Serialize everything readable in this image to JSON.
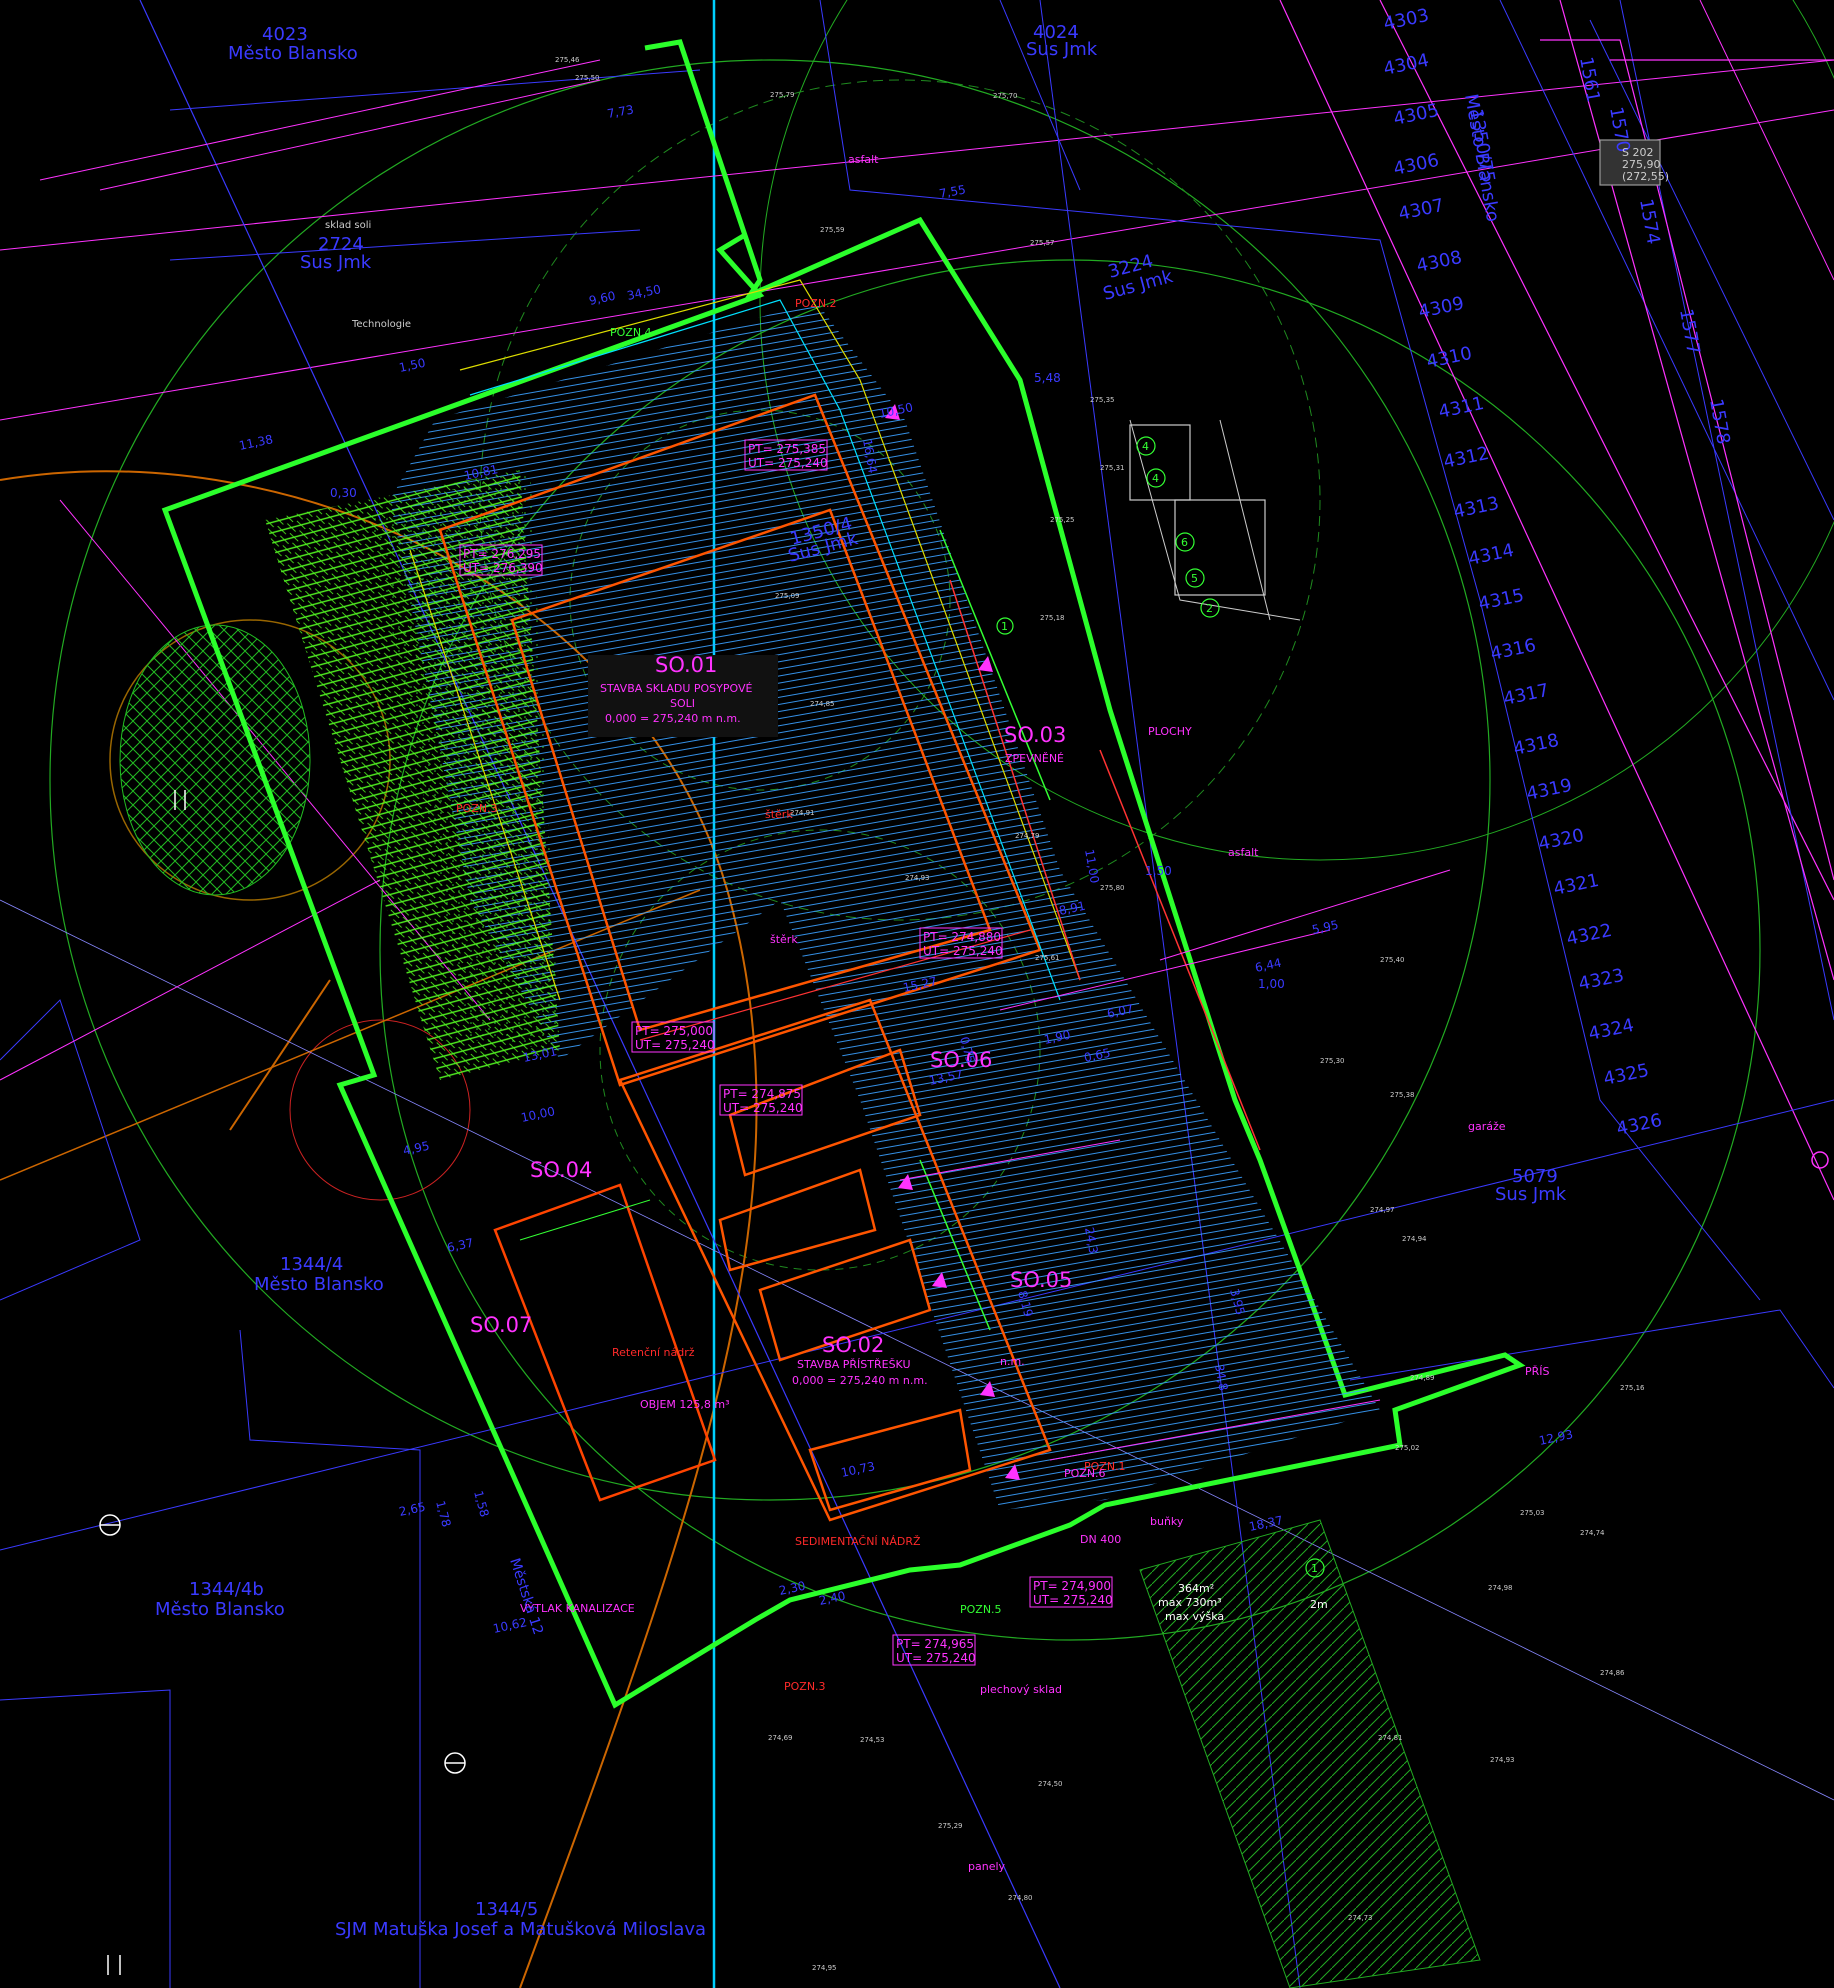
{
  "parcels": [
    {
      "num": "4023",
      "owner": "Město Blansko"
    },
    {
      "num": "4024",
      "owner": "Sus Jmk"
    },
    {
      "num": "2724",
      "owner": "Sus Jmk"
    },
    {
      "num": "3224",
      "owner": "Sus Jmk"
    },
    {
      "num": "1350/4",
      "owner": "Sus Jmk"
    },
    {
      "num": "5079",
      "owner": "Sus Jmk"
    },
    {
      "num": "1344/4",
      "owner": "Město Blansko"
    },
    {
      "num": "1344/4b",
      "owner": "Město Blansko"
    },
    {
      "num": "1344/5",
      "owner": "SJM Matuška Josef a Matušková Miloslava"
    },
    {
      "num": "1350/75",
      "owner": "Město Blansko"
    }
  ],
  "parcel_side_numbers": [
    "4303",
    "4304",
    "4305",
    "4306",
    "4307",
    "4308",
    "4309",
    "4310",
    "4311",
    "4312",
    "4313",
    "4314",
    "4315",
    "4316",
    "4317",
    "4318",
    "4319",
    "4320",
    "4321",
    "4322",
    "4323",
    "4324",
    "4325",
    "4326"
  ],
  "right_column_numbers": [
    "1561",
    "1570",
    "1574",
    "1577",
    "1578"
  ],
  "objects": {
    "so01": {
      "code": "SO.01",
      "l1": "STAVBA SKLADU POSYPOVÉ",
      "l2": "SOLI",
      "l3": "0,000 = 275,240 m n.m."
    },
    "so02": {
      "code": "SO.02",
      "l1": "STAVBA PŘÍSTŘEŠKU",
      "l2": "0,000 = 275,240 m n.m."
    },
    "so03": {
      "code": "SO.03",
      "l1": "ZPEVNĚNÉ",
      "l2": "PLOCHY"
    },
    "so04": {
      "code": "SO.04"
    },
    "so05": {
      "code": "SO.05",
      "l1": "n.m."
    },
    "so06": {
      "code": "SO.06"
    },
    "so07": {
      "code": "SO.07"
    }
  },
  "notes": {
    "pozn1": "POZN.1",
    "pozn2": "POZN.2",
    "pozn3": "POZN.3",
    "pozn3b": "POZN.3",
    "pozn4": "POZN.4",
    "pozn5": "POZN.5",
    "pozn6": "POZN.6",
    "retencni": "Retenční nádrž",
    "objem": "OBJEM 125,8 m³",
    "vytlak": "VÝTLAK KANALIZACE",
    "sedim": "SEDIMENTAČNÍ NÁDRŽ",
    "technologie": "Technologie",
    "sklad_soli": "sklad soli",
    "asfalt": "asfalt",
    "asfalt2": "asfalt",
    "sterk": "štěrk",
    "sterk2": "štěrk",
    "garaze": "garáže",
    "plechovy": "plechový sklad",
    "panely": "panely",
    "pris": "PŘÍS",
    "stack1": "364m²",
    "stack2": "max 730m³",
    "stack3": "max výška",
    "stack4": "2m",
    "bunky": "buňky",
    "dn400": "DN 400",
    "s202": "S 202",
    "s202v": "275,90",
    "s202p": "(272,55)",
    "u12": "Městská 12"
  },
  "level_boxes": [
    {
      "pt": "PT= 276,295",
      "ut": "UT= 276,390"
    },
    {
      "pt": "PT= 275,385",
      "ut": "UT= 275,240"
    },
    {
      "pt": "PT= 274,880",
      "ut": "UT= 275,240"
    },
    {
      "pt": "PT= 275,000",
      "ut": "UT= 275,240"
    },
    {
      "pt": "PT= 274,875",
      "ut": "UT= 275,240"
    },
    {
      "pt": "PT= 274,900",
      "ut": "UT= 275,240"
    },
    {
      "pt": "PT= 274,965",
      "ut": "UT= 275,240"
    }
  ],
  "dimensions": [
    "7,73",
    "7,55",
    "9,60",
    "34,50",
    "1,50",
    "11,38",
    "0,30",
    "10,81",
    "5,48",
    "10,50",
    "16,64",
    "11,00",
    "1,50",
    "8,91",
    "6,44",
    "1,00",
    "5,95",
    "15,27",
    "13,01",
    "10,00",
    "4,95",
    "6,37",
    "13,57",
    "6,07",
    "0,65",
    "2,65",
    "1,78",
    "1,58",
    "10,62",
    "10,73",
    "12,93",
    "18,37",
    "34,8",
    "24,3",
    "2,30",
    "2,40",
    "8,19",
    "0,75",
    "1,90",
    "3,95"
  ],
  "numbered_circles": [
    "4",
    "4",
    "6",
    "5",
    "2",
    "1",
    "1"
  ],
  "spot_heights": [
    "275,46",
    "275,50",
    "275,79",
    "275,70",
    "275,59",
    "275,57",
    "275,35",
    "275,31",
    "275,25",
    "275,18",
    "275,09",
    "274,85",
    "274,91",
    "274,93",
    "274,79",
    "275,80",
    "275,61",
    "275,40",
    "275,30",
    "275,38",
    "274,94",
    "274,97",
    "274,89",
    "275,16",
    "275,03",
    "274,74",
    "274,86",
    "274,81",
    "274,93",
    "274,53",
    "274,50",
    "274,69",
    "275,29",
    "274,80",
    "274,95",
    "274,98",
    "274,73",
    "275,02"
  ],
  "colors": {
    "boundary": "#2bff2b",
    "building": "#ff5500",
    "pink": "#ff33ff",
    "blue": "#3a3aff",
    "cyan": "#00e0ff",
    "green": "#22cc22",
    "yellow": "#ffdd00",
    "brown": "#cc6600",
    "red": "#ff2a2a"
  }
}
